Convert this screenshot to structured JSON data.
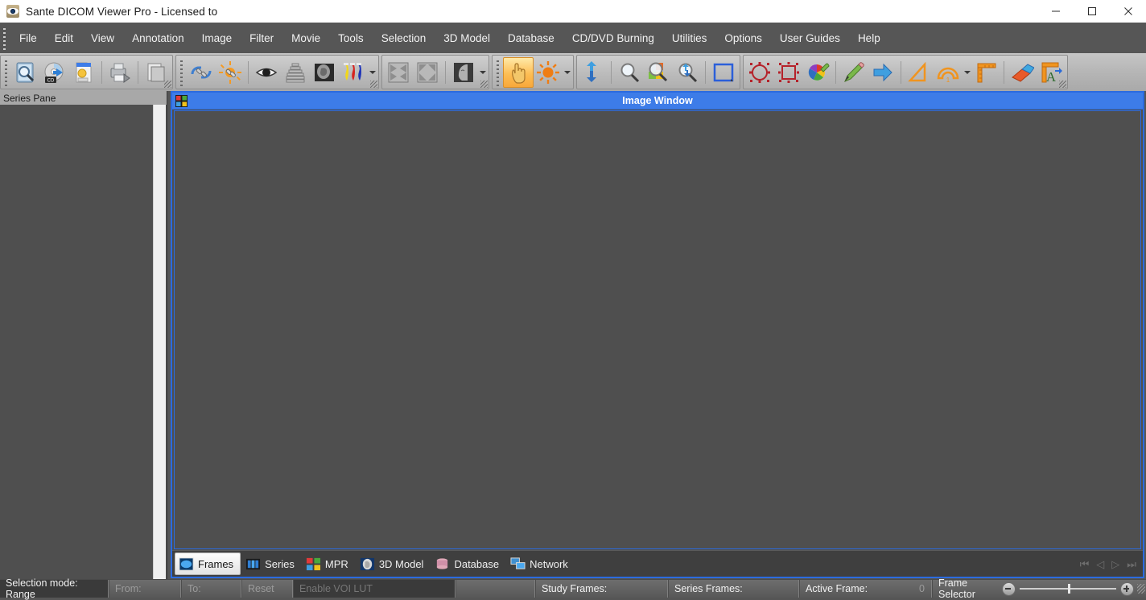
{
  "window": {
    "title": "Sante DICOM Viewer Pro - Licensed to",
    "app_icon": "eye-icon",
    "controls": {
      "minimize": "minimize-icon",
      "maximize": "maximize-icon",
      "close": "close-icon"
    }
  },
  "menubar": {
    "items": [
      {
        "label": "File"
      },
      {
        "label": "Edit"
      },
      {
        "label": "View"
      },
      {
        "label": "Annotation"
      },
      {
        "label": "Image"
      },
      {
        "label": "Filter"
      },
      {
        "label": "Movie"
      },
      {
        "label": "Tools"
      },
      {
        "label": "Selection"
      },
      {
        "label": "3D Model"
      },
      {
        "label": "Database"
      },
      {
        "label": "CD/DVD Burning"
      },
      {
        "label": "Utilities"
      },
      {
        "label": "Options"
      },
      {
        "label": "User Guides"
      },
      {
        "label": "Help"
      }
    ]
  },
  "toolbar": {
    "groups": [
      {
        "name": "file-group",
        "buttons": [
          {
            "icon": "open-search-icon",
            "active": false
          },
          {
            "icon": "cd-import-icon",
            "active": false
          },
          {
            "icon": "export-file-icon",
            "active": false
          },
          {
            "icon": "print-icon",
            "active": false
          },
          {
            "icon": "copy-icon",
            "active": false
          }
        ]
      },
      {
        "name": "sync-group",
        "buttons": [
          {
            "icon": "link-sync-icon",
            "active": false
          },
          {
            "icon": "link-brightness-icon",
            "active": false
          },
          {
            "icon": "eye-view-icon",
            "active": false
          },
          {
            "icon": "stack-icon",
            "active": false
          },
          {
            "icon": "head-scan-icon",
            "active": false
          },
          {
            "icon": "colormap-icon",
            "active": false
          }
        ]
      },
      {
        "name": "layout-group",
        "buttons": [
          {
            "icon": "fit-inward-icon",
            "active": false
          },
          {
            "icon": "fit-outward-icon",
            "active": false
          },
          {
            "icon": "profile-scan-icon",
            "active": false
          }
        ]
      },
      {
        "name": "interaction-group",
        "buttons": [
          {
            "icon": "pan-hand-icon",
            "active": true
          },
          {
            "icon": "brightness-sun-icon",
            "active": false
          }
        ]
      },
      {
        "name": "zoom-group",
        "buttons": [
          {
            "icon": "scroll-frames-icon",
            "active": false
          },
          {
            "icon": "zoom-icon",
            "active": false
          },
          {
            "icon": "zoom-region-icon",
            "active": false
          },
          {
            "icon": "zoom-fit-icon",
            "active": false
          },
          {
            "icon": "rectangle-select-icon",
            "active": false
          }
        ]
      },
      {
        "name": "annotation-group",
        "buttons": [
          {
            "icon": "ellipse-roi-icon",
            "active": false
          },
          {
            "icon": "rectangle-roi-icon",
            "active": false
          },
          {
            "icon": "color-picker-icon",
            "active": false
          },
          {
            "icon": "pencil-icon",
            "active": false
          },
          {
            "icon": "arrow-icon",
            "active": false
          },
          {
            "icon": "angle-icon",
            "active": false
          },
          {
            "icon": "protractor-icon",
            "active": false
          },
          {
            "icon": "ruler-icon",
            "active": false
          },
          {
            "icon": "eraser-icon",
            "active": false
          },
          {
            "icon": "text-annotation-icon",
            "active": false
          }
        ]
      }
    ]
  },
  "series_pane": {
    "title": "Series Pane"
  },
  "image_window": {
    "title": "Image Window",
    "icon": "grid-layout-icon",
    "tabs": [
      {
        "label": "Frames",
        "icon": "frames-icon",
        "active": true
      },
      {
        "label": "Series",
        "icon": "series-icon",
        "active": false
      },
      {
        "label": "MPR",
        "icon": "mpr-icon",
        "active": false
      },
      {
        "label": "3D Model",
        "icon": "3d-model-icon",
        "active": false
      },
      {
        "label": "Database",
        "icon": "database-icon",
        "active": false
      },
      {
        "label": "Network",
        "icon": "network-icon",
        "active": false
      }
    ],
    "nav": [
      {
        "icon": "first-frame-icon",
        "glyph": "⏮"
      },
      {
        "icon": "prev-frame-icon",
        "glyph": "◁"
      },
      {
        "icon": "next-frame-icon",
        "glyph": "▷"
      },
      {
        "icon": "last-frame-icon",
        "glyph": "⏭"
      }
    ]
  },
  "statusbar": {
    "selection_mode": "Selection mode: Range",
    "from_label": "From:",
    "from_value": "",
    "to_label": "To:",
    "to_value": "",
    "reset_label": "Reset",
    "enable_voi_lut": "Enable VOI LUT",
    "study_frames_label": "Study Frames:",
    "study_frames_value": "",
    "series_frames_label": "Series Frames:",
    "series_frames_value": "",
    "active_frame_label": "Active Frame:",
    "active_frame_value": "0",
    "frame_selector_label": "Frame Selector",
    "frame_selector_minus": "zoom-out-icon",
    "frame_selector_plus": "zoom-in-icon"
  },
  "colors": {
    "accent_blue": "#3d7ce8",
    "toolbar_grey": "#bdbdbd",
    "menu_grey": "#565656",
    "canvas_grey": "#4f4f4f",
    "active_tool": "#fdbe55"
  }
}
